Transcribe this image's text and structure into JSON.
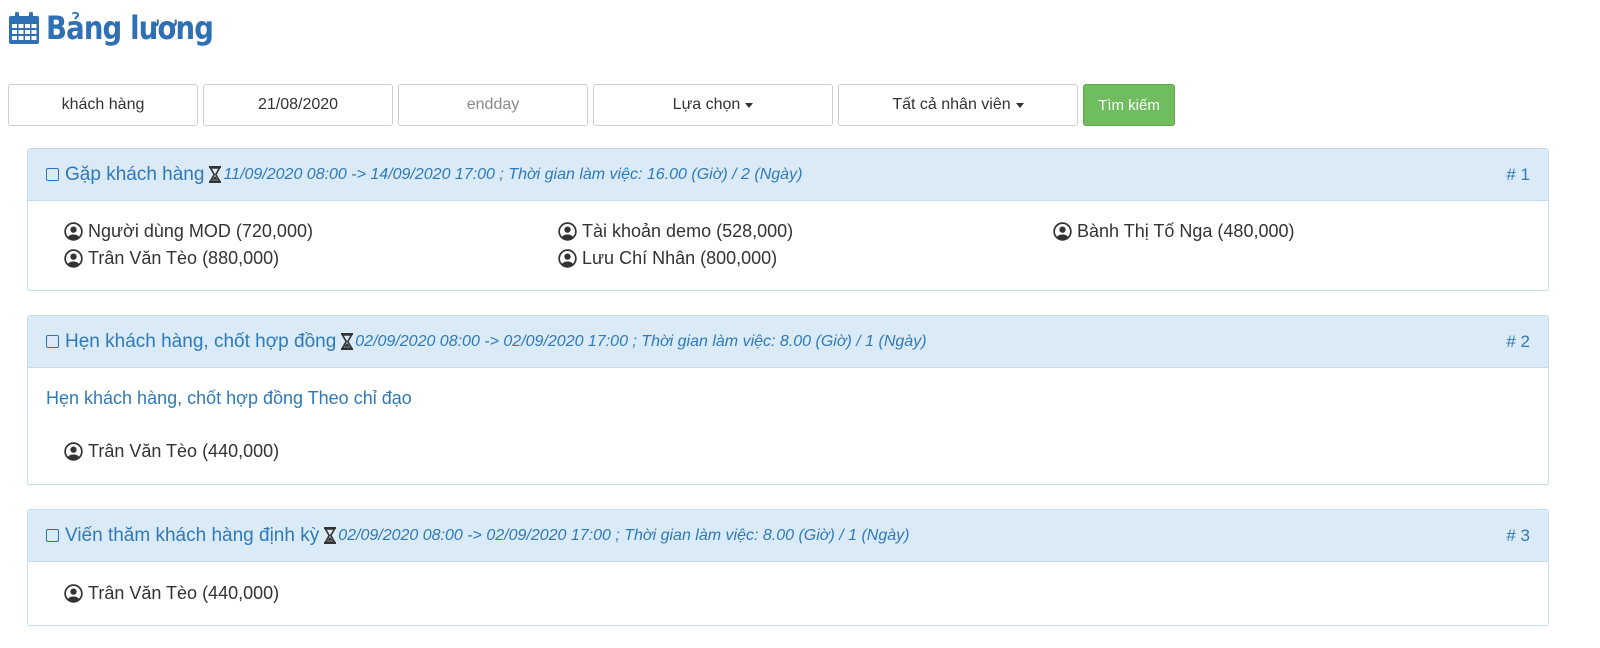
{
  "header": {
    "title": "Bảng lương",
    "icon": "calendar-icon"
  },
  "filters": {
    "customer": {
      "value": "khách hàng"
    },
    "start_date": {
      "value": "21/08/2020"
    },
    "end_date": {
      "placeholder": "endday"
    },
    "choice": {
      "label": "Lựa chọn"
    },
    "staff": {
      "label": "Tất cả nhân viên"
    },
    "search_label": "Tìm kiếm"
  },
  "tasks": [
    {
      "title": "Gặp khách hàng",
      "meta": "11/09/2020 08:00 -> 14/09/2020 17:00 ; Thời gian làm việc: 16.00 (Giờ) / 2 (Ngày)",
      "number": "# 1",
      "description": "",
      "people": [
        "Người dùng MOD (720,000)",
        "Tài khoản demo (528,000)",
        "Bành Thị Tố Nga (480,000)",
        "Trân Văn Tèo (880,000)",
        "Lưu Chí Nhân (800,000)"
      ]
    },
    {
      "title": "Hẹn khách hàng, chốt hợp đồng",
      "meta": "02/09/2020 08:00 -> 02/09/2020 17:00 ; Thời gian làm việc: 8.00 (Giờ) / 1 (Ngày)",
      "number": "# 2",
      "description": "Hẹn khách hàng, chốt hợp đồng Theo chỉ đạo",
      "people": [
        "Trân Văn Tèo (440,000)"
      ]
    },
    {
      "title": "Viến thăm khách hàng định kỳ",
      "meta": "02/09/2020 08:00 -> 02/09/2020 17:00 ; Thời gian làm việc: 8.00 (Giờ) / 1 (Ngày)",
      "number": "# 3",
      "description": "",
      "people": [
        "Trân Văn Tèo (440,000)"
      ]
    }
  ],
  "colors": {
    "accent": "#2f7ab8",
    "panel_header": "#daeaf6",
    "search_button": "#6fbd5f"
  }
}
